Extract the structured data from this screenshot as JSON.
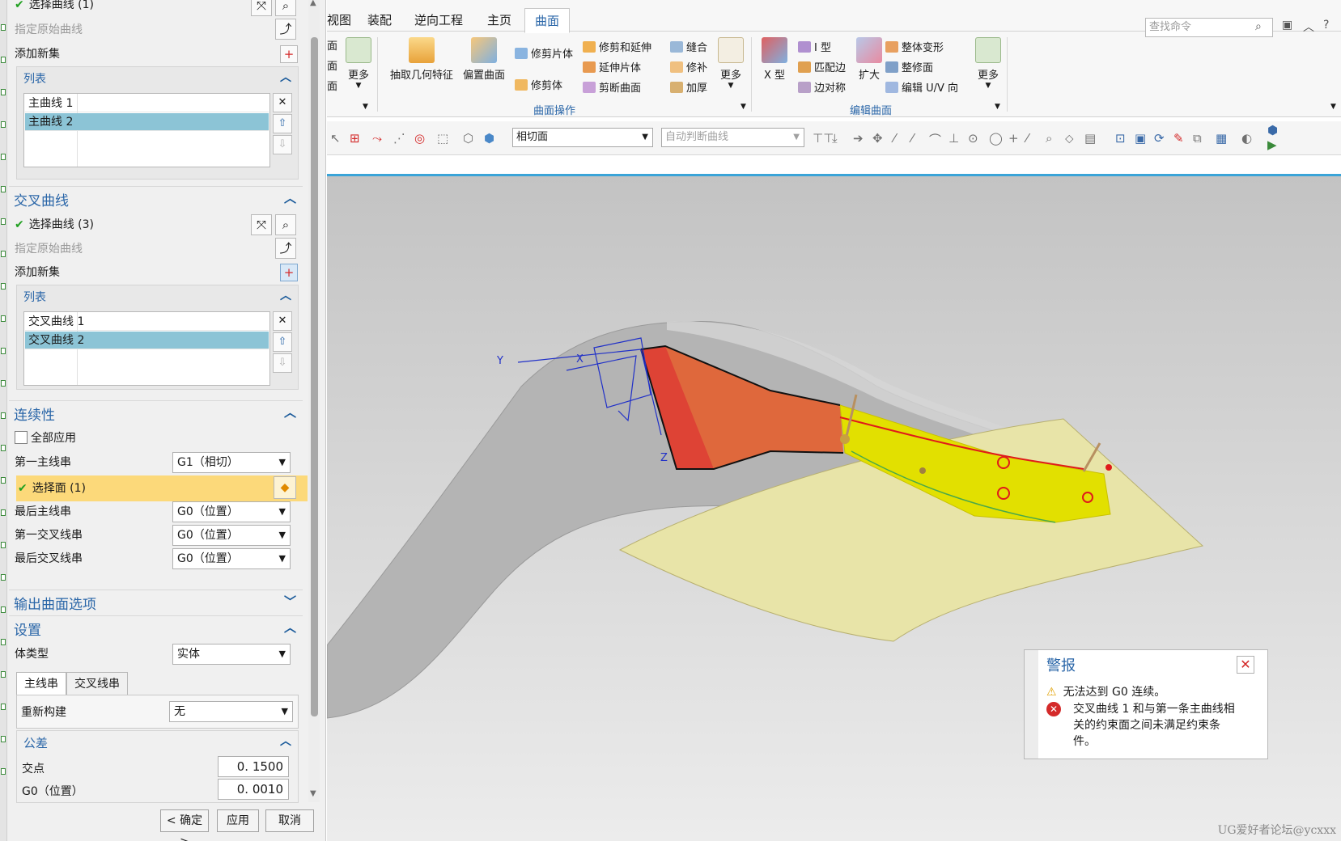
{
  "dialog": {
    "primary": {
      "select_curve": "选择曲线 (1)",
      "specify_origin": "指定原始曲线",
      "add_new_set": "添加新集",
      "list_title": "列表",
      "items": [
        "主曲线 1",
        "主曲线 2"
      ]
    },
    "cross": {
      "title": "交叉曲线",
      "select_curve": "选择曲线 (3)",
      "specify_origin": "指定原始曲线",
      "add_new_set": "添加新集",
      "list_title": "列表",
      "items": [
        "交叉曲线 1",
        "交叉曲线 2"
      ]
    },
    "continuity": {
      "title": "连续性",
      "apply_all": "全部应用",
      "first_primary_label": "第一主线串",
      "first_primary_value": "G1（相切）",
      "select_face": "选择面 (1)",
      "last_primary_label": "最后主线串",
      "last_primary_value": "G0（位置）",
      "first_cross_label": "第一交叉线串",
      "first_cross_value": "G0（位置）",
      "last_cross_label": "最后交叉线串",
      "last_cross_value": "G0（位置）"
    },
    "output_options": {
      "title": "输出曲面选项"
    },
    "settings": {
      "title": "设置",
      "body_type_label": "体类型",
      "body_type_value": "实体",
      "tabs": [
        "主线串",
        "交叉线串"
      ],
      "rebuild_label": "重新构建",
      "rebuild_value": "无",
      "tolerance_title": "公差",
      "intersection_label": "交点",
      "intersection_value": "0. 1500",
      "g0_label": "G0（位置）",
      "g0_value": "0. 0010"
    },
    "buttons": {
      "ok": "< 确定 >",
      "apply": "应用",
      "cancel": "取消"
    }
  },
  "ribbon": {
    "tabs": [
      "视图",
      "装配",
      "逆向工程",
      "主页",
      "曲面"
    ],
    "active_tab": "曲面",
    "search_placeholder": "查找命令",
    "left_partial": [
      "面",
      "面",
      "面"
    ],
    "more": "更多",
    "extract_geometry": "抽取几何特征",
    "offset_surface": "偏置曲面",
    "trim_sheet": "修剪片体",
    "trim_body": "修剪体",
    "trim_extend": "修剪和延伸",
    "extend_sheet": "延伸片体",
    "split_surface": "剪断曲面",
    "sew": "缝合",
    "patch": "修补",
    "thicken": "加厚",
    "x_form": "X 型",
    "i_form": "I 型",
    "match_edge": "匹配边",
    "edge_symmetry": "边对称",
    "enlarge": "扩大",
    "global_shaping": "整体变形",
    "fix_surface": "整修面",
    "edit_uv": "编辑 U/V 向",
    "group_surface_ops": "曲面操作",
    "group_edit_surface": "编辑曲面"
  },
  "selection_bar": {
    "face_rule": "相切面",
    "curve_rule": "自动判断曲线"
  },
  "viewport": {
    "axis_y": "Y",
    "axis_x": "X",
    "axis_z": "Z",
    "watermark": "UG爱好者论坛@ycxxx"
  },
  "alert": {
    "title": "警报",
    "warning": "无法达到 G0 连续。",
    "error": "交叉曲线 1 和与第一条主曲线相关的约束面之间未满足约束条件。"
  }
}
